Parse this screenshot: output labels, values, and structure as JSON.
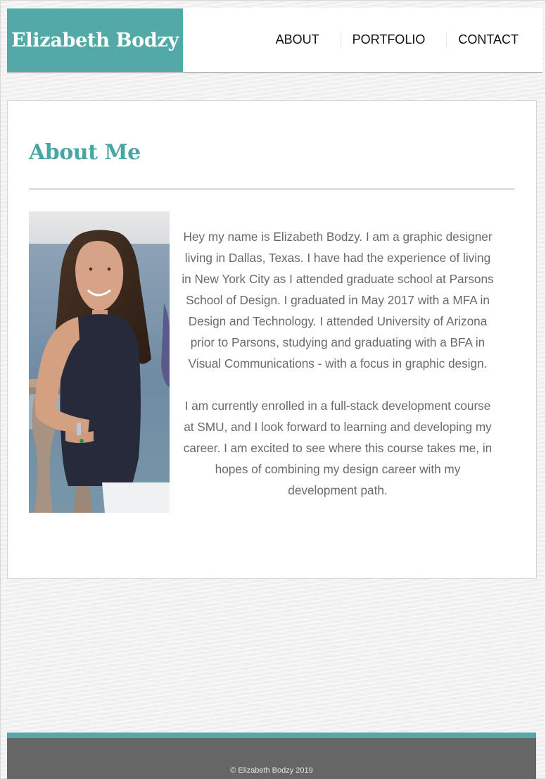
{
  "header": {
    "brand_name": "Elizabeth Bodzy",
    "nav": {
      "about": "ABOUT",
      "portfolio": "PORTFOLIO",
      "contact": "CONTACT"
    }
  },
  "main": {
    "title": "About Me",
    "paragraphs": [
      "Hey my name is Elizabeth Bodzy. I am a graphic designer living in Dallas, Texas. I have had the experience of living in New York City as I attended graduate school at Parsons School of Design. I graduated in May 2017 with a MFA in Design and Technology. I attended University of Arizona prior to Parsons, studying and graduating with a BFA in Visual Communications - with a focus in graphic design.",
      "I am currently enrolled in a full-stack development course at SMU, and I look forward to learning and developing my career. I am excited to see where this course takes me, in hopes of combining my design career with my development path."
    ]
  },
  "footer": {
    "copyright": "© Elizabeth Bodzy 2019"
  },
  "colors": {
    "accent": "#52a9a5",
    "title": "#4aa6a2",
    "footer": "#666666"
  }
}
